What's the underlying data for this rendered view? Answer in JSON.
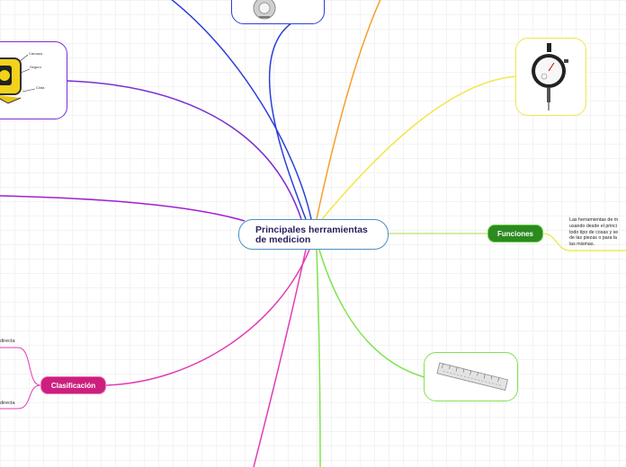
{
  "central": {
    "title": "Principales herramientas de medicion"
  },
  "funciones": {
    "label": "Funciones",
    "note": "Las herramientas de m\nusando desde el princi\ntodo tipo de cosas y se\nde las piezas o para la\nlas mismas."
  },
  "clasificacion": {
    "label": "Clasificación",
    "children": [
      "directa",
      "directa"
    ]
  },
  "images": {
    "tape_labels": [
      "Carcaza",
      "Seguro",
      "Cinta"
    ]
  },
  "colors": {
    "central_border": "#4a90c2",
    "funciones": "#2b8a1e",
    "clasificacion": "#cc1f7e",
    "branch_blue": "#2b3fd9",
    "branch_orange": "#f5a02a",
    "branch_yellow": "#f2e64a",
    "branch_purple": "#7a2ed1",
    "branch_violet": "#a11fd1",
    "branch_green": "#7ee34d",
    "branch_pink": "#e23cb5"
  }
}
